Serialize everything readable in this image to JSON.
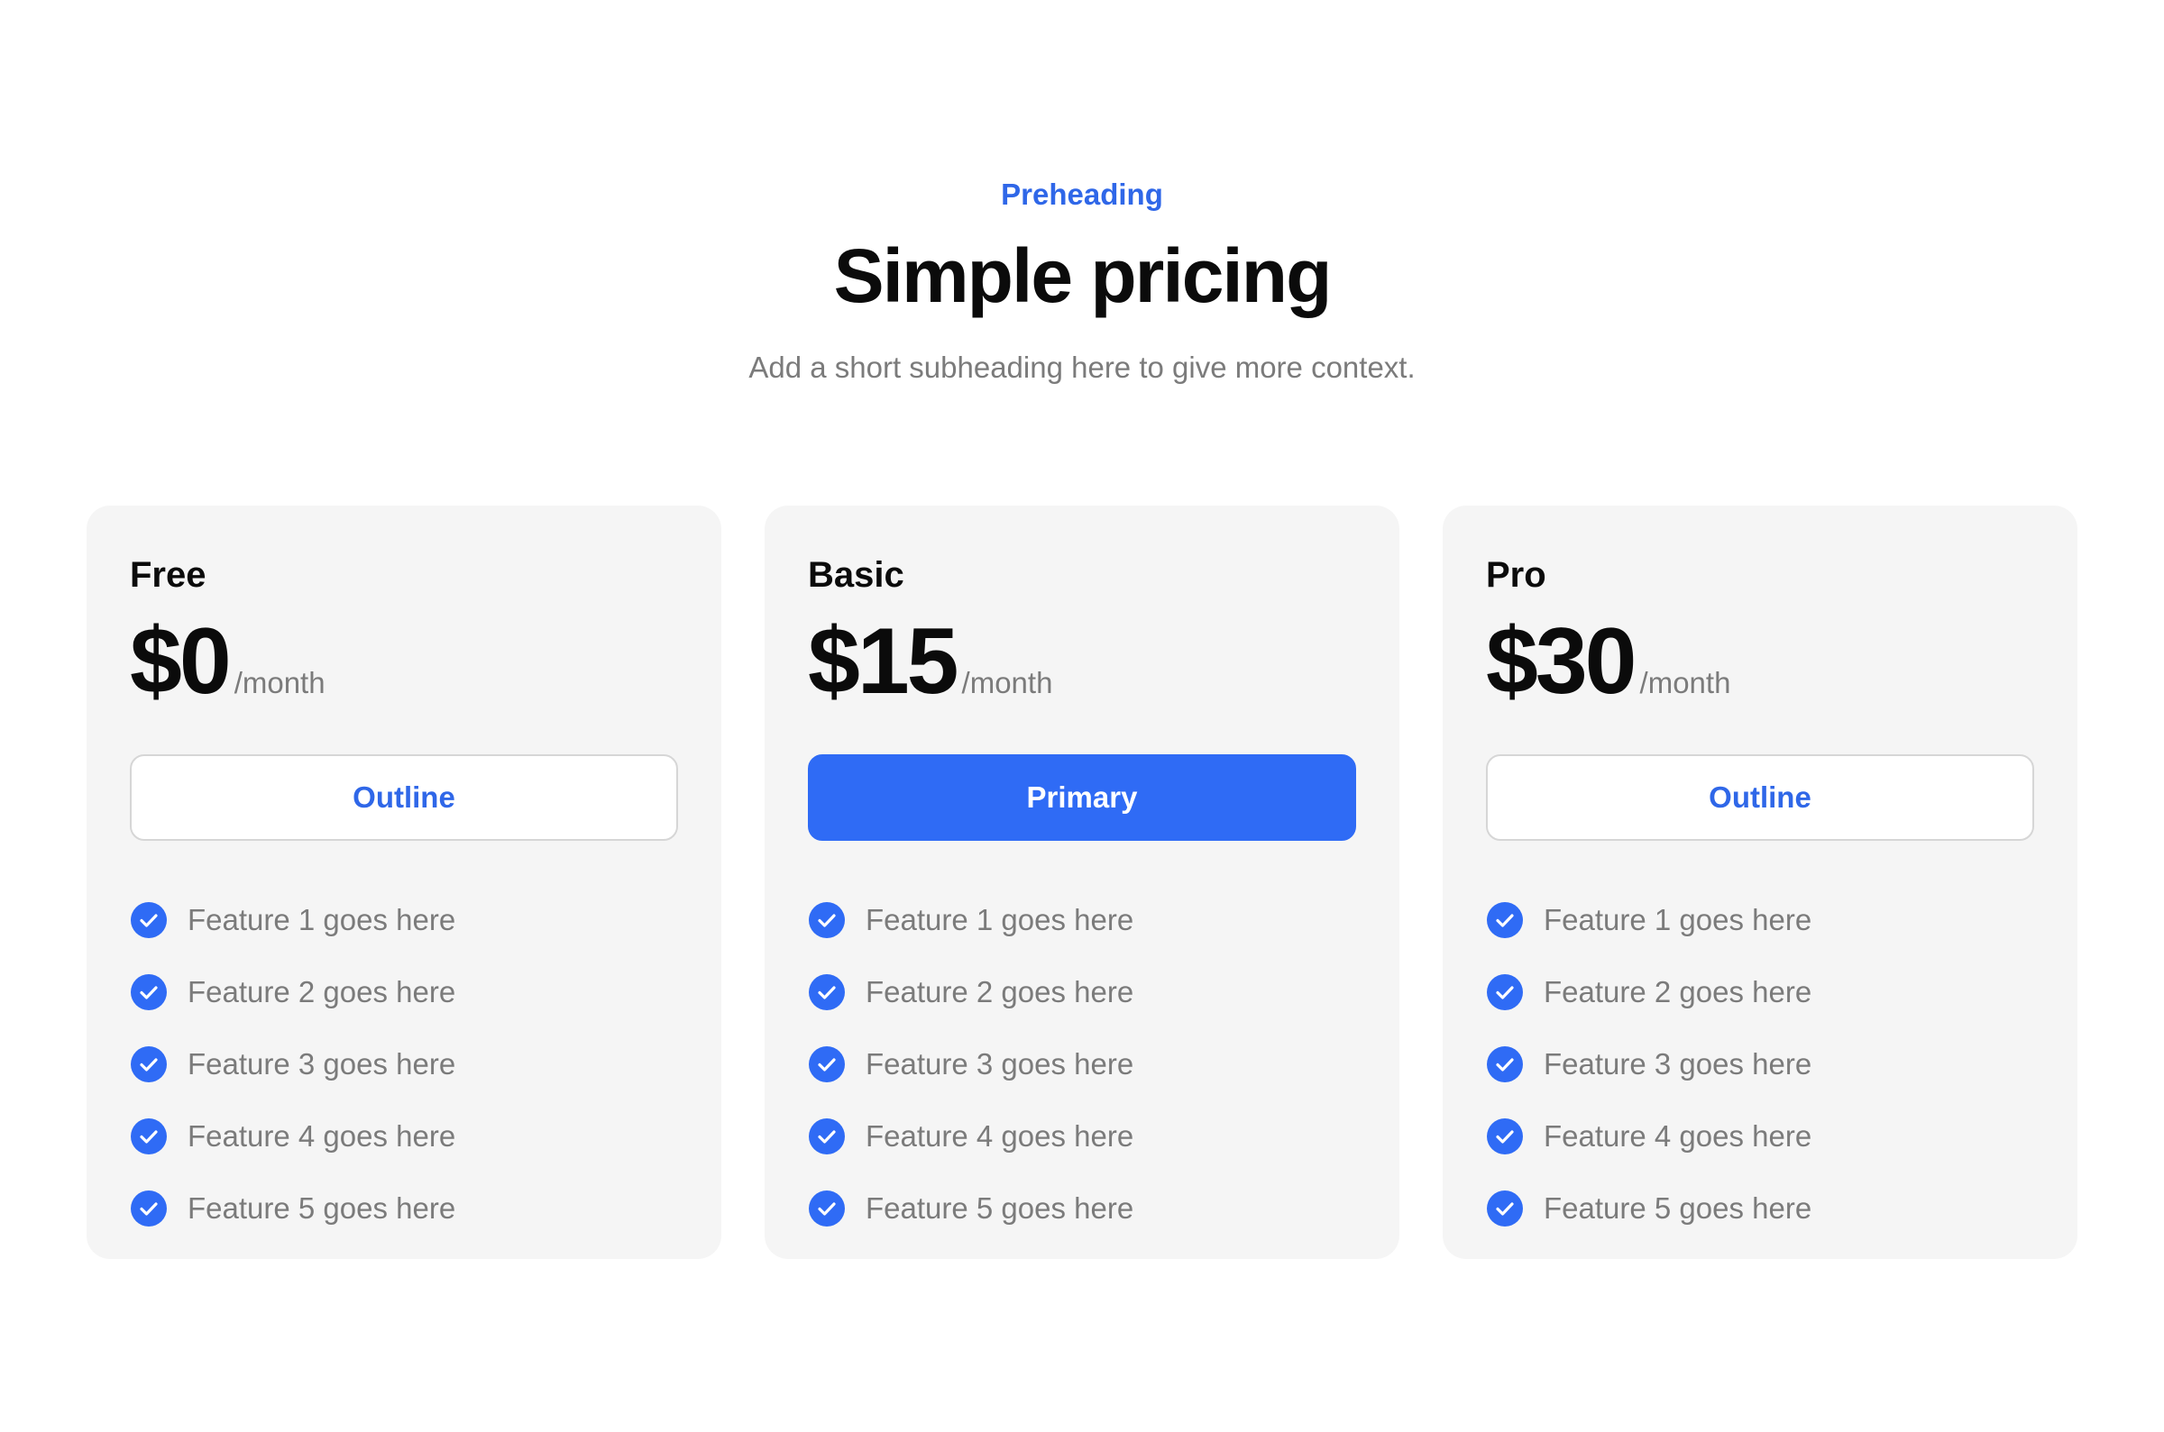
{
  "header": {
    "preheading": "Preheading",
    "title": "Simple pricing",
    "subheading": "Add a short subheading here to give more context."
  },
  "colors": {
    "accent": "#2f6bf5",
    "accent_text": "#2f67e8",
    "card_background": "#f5f5f5",
    "muted_text": "#7b7b7b"
  },
  "plans": [
    {
      "name": "Free",
      "price": "$0",
      "period": "/month",
      "button": {
        "label": "Outline",
        "style": "outline"
      },
      "features": [
        "Feature 1 goes here",
        "Feature 2 goes here",
        "Feature 3 goes here",
        "Feature 4 goes here",
        "Feature 5 goes here"
      ],
      "feature_icon": "check-circle-icon"
    },
    {
      "name": "Basic",
      "price": "$15",
      "period": "/month",
      "button": {
        "label": "Primary",
        "style": "primary"
      },
      "features": [
        "Feature 1 goes here",
        "Feature 2 goes here",
        "Feature 3 goes here",
        "Feature 4 goes here",
        "Feature 5 goes here"
      ],
      "feature_icon": "check-circle-icon"
    },
    {
      "name": "Pro",
      "price": "$30",
      "period": "/month",
      "button": {
        "label": "Outline",
        "style": "outline"
      },
      "features": [
        "Feature 1 goes here",
        "Feature 2 goes here",
        "Feature 3 goes here",
        "Feature 4 goes here",
        "Feature 5 goes here"
      ],
      "feature_icon": "check-circle-icon"
    }
  ]
}
